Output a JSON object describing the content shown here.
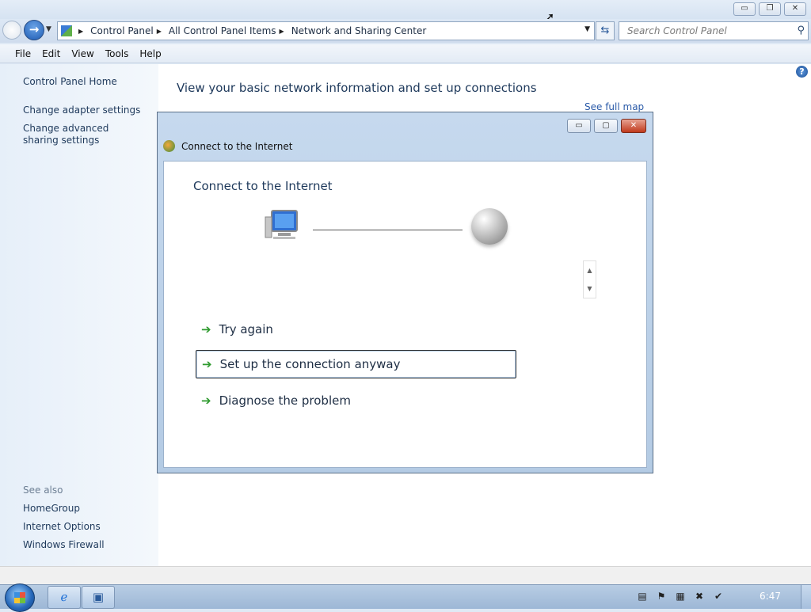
{
  "window": {
    "controls": {
      "minimize": "▭",
      "maximize": "❐",
      "close": "✕"
    }
  },
  "address": {
    "breadcrumbs": [
      "Control Panel",
      "All Control Panel Items",
      "Network and Sharing Center"
    ],
    "search_placeholder": "Search Control Panel"
  },
  "menu": {
    "items": [
      "File",
      "Edit",
      "View",
      "Tools",
      "Help"
    ]
  },
  "sidebar": {
    "home": "Control Panel Home",
    "links": [
      "Change adapter settings",
      "Change advanced sharing settings"
    ],
    "see_also_heading": "See also",
    "see_also": [
      "HomeGroup",
      "Internet Options",
      "Windows Firewall"
    ]
  },
  "main": {
    "title": "View your basic network information and set up connections",
    "see_full_map": "See full map"
  },
  "dialog": {
    "title": "Connect to the Internet",
    "heading": "Connect to the Internet",
    "options": [
      "Try again",
      "Set up the connection anyway",
      "Diagnose the problem"
    ],
    "focused_option_index": 1
  },
  "taskbar": {
    "clock": "6:47"
  }
}
